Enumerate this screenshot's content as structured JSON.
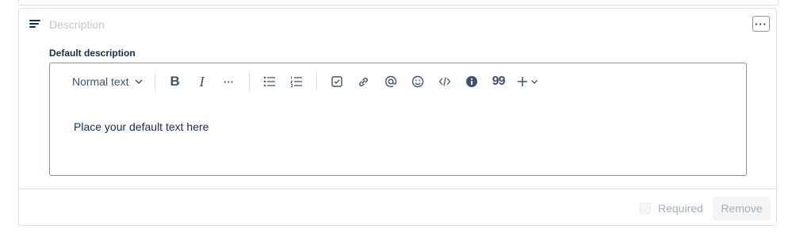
{
  "field": {
    "title_placeholder": "Description",
    "more_label": "···",
    "default_label": "Default description"
  },
  "toolbar": {
    "text_style": "Normal text",
    "bold": "B",
    "italic": "I",
    "more": "···",
    "quote": "99"
  },
  "editor": {
    "content": "Place your default text here"
  },
  "footer": {
    "required_label": "Required",
    "remove_label": "Remove"
  }
}
